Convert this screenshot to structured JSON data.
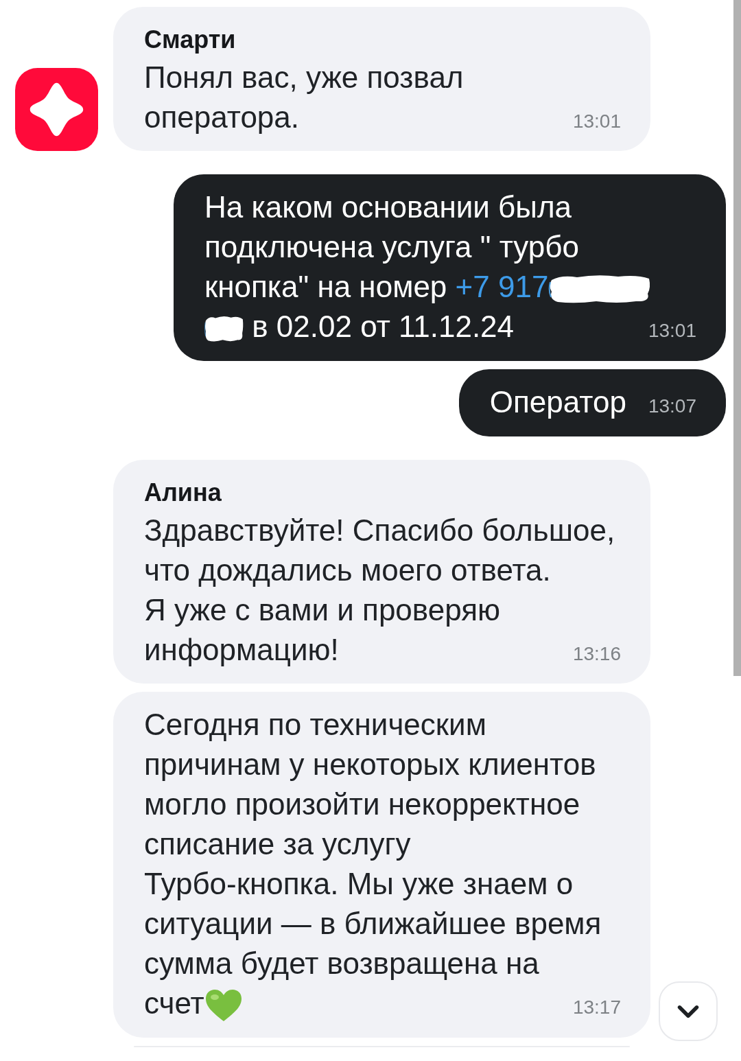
{
  "messages": [
    {
      "kind": "incoming",
      "avatar": true,
      "sender": "Смарти",
      "parts": [
        {
          "kind": "text",
          "text": "Понял вас, уже позвал\nоператора."
        }
      ],
      "time": "13:01"
    },
    {
      "kind": "outgoing",
      "parts": [
        {
          "kind": "text",
          "text": "На каком основании была\nподключена услуга \" турбо\nкнопка\" на номер "
        },
        {
          "kind": "link",
          "text": "+7 917"
        },
        {
          "kind": "redacted"
        },
        {
          "kind": "text",
          "text": " в 02.02 от 11.12.24"
        }
      ],
      "time": "13:01"
    },
    {
      "kind": "outgoing",
      "parts": [
        {
          "kind": "text",
          "text": "Оператор"
        }
      ],
      "time": "13:07"
    },
    {
      "kind": "incoming",
      "avatar": false,
      "sender": "Алина",
      "parts": [
        {
          "kind": "text",
          "text": "Здравствуйте! Спасибо большое,\nчто дождались моего ответа.\nЯ уже с вами и проверяю\nинформацию!"
        }
      ],
      "time": "13:16"
    },
    {
      "kind": "incoming",
      "avatar": false,
      "parts": [
        {
          "kind": "text",
          "text": "Сегодня по техническим\nпричинам у некоторых клиентов\nмогло произойти некорректное\nсписание за услугу\nТурбо-кнопка. Мы уже знаем о\nситуации — в ближайшее время\nсумма будет возвращена на\nсчет"
        },
        {
          "kind": "emoji"
        }
      ],
      "time": "13:17"
    }
  ]
}
